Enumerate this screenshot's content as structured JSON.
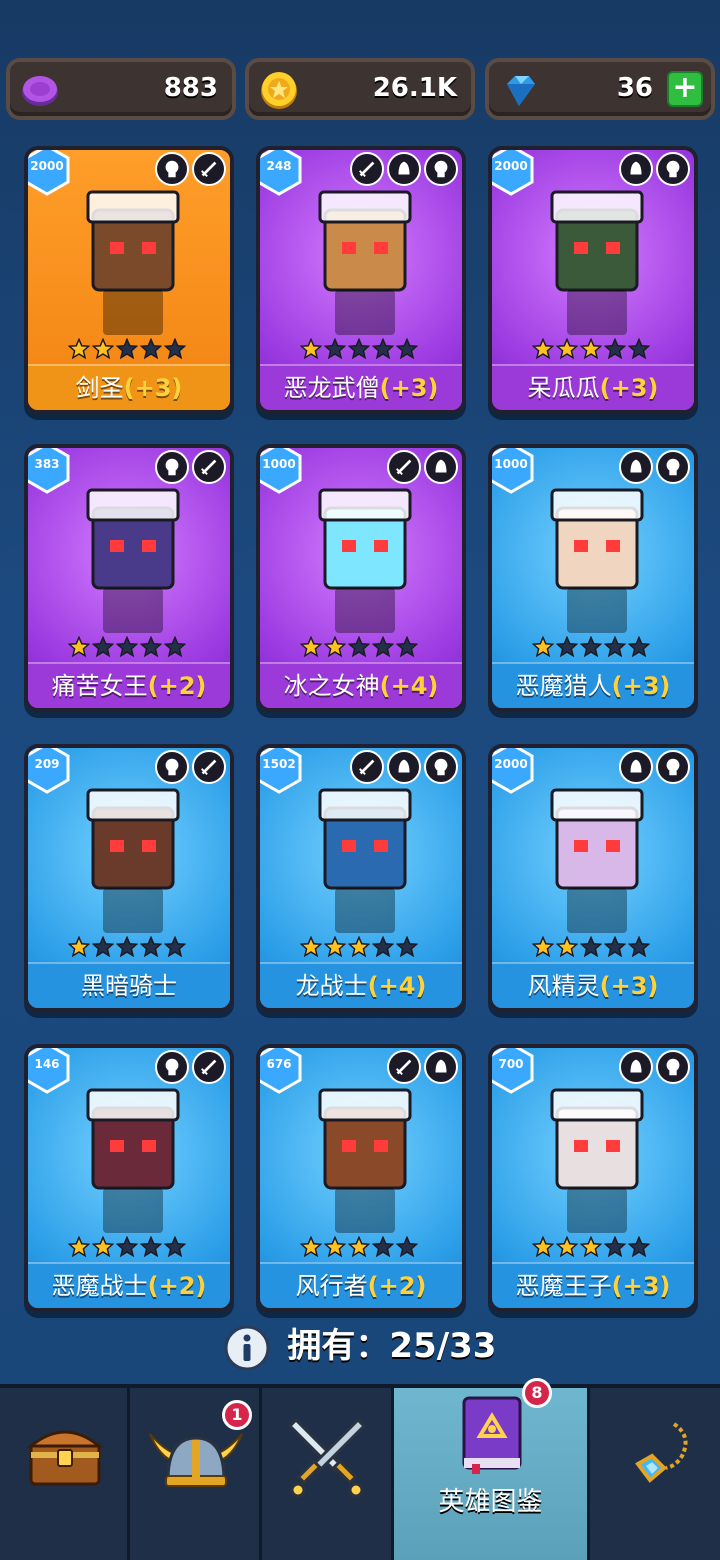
{
  "currencies": [
    {
      "icon": "purple-gem-icon",
      "value": "883"
    },
    {
      "icon": "gold-coin-icon",
      "value": "26.1K"
    },
    {
      "icon": "diamond-icon",
      "value": "36"
    }
  ],
  "plus_label": "+",
  "heroes": [
    {
      "name": "剑圣",
      "bonus": "(+3)",
      "level": "2000",
      "stars": 2,
      "rarity": "gold"
    },
    {
      "name": "恶龙武僧",
      "bonus": "(+3)",
      "level": "248",
      "stars": 1,
      "rarity": "purple"
    },
    {
      "name": "呆瓜瓜",
      "bonus": "(+3)",
      "level": "2000",
      "stars": 3,
      "rarity": "purple"
    },
    {
      "name": "痛苦女王",
      "bonus": "(+2)",
      "level": "383",
      "stars": 1,
      "rarity": "purple"
    },
    {
      "name": "冰之女神",
      "bonus": "(+4)",
      "level": "1000",
      "stars": 2,
      "rarity": "purple"
    },
    {
      "name": "恶魔猎人",
      "bonus": "(+3)",
      "level": "1000",
      "stars": 1,
      "rarity": "blue"
    },
    {
      "name": "黑暗骑士",
      "bonus": "",
      "level": "209",
      "stars": 1,
      "rarity": "blue"
    },
    {
      "name": "龙战士",
      "bonus": "(+4)",
      "level": "1502",
      "stars": 3,
      "rarity": "blue"
    },
    {
      "name": "风精灵",
      "bonus": "(+3)",
      "level": "2000",
      "stars": 2,
      "rarity": "blue"
    },
    {
      "name": "恶魔战士",
      "bonus": "(+2)",
      "level": "146",
      "stars": 2,
      "rarity": "blue"
    },
    {
      "name": "风行者",
      "bonus": "(+2)",
      "level": "676",
      "stars": 3,
      "rarity": "blue"
    },
    {
      "name": "恶魔王子",
      "bonus": "(+3)",
      "level": "700",
      "stars": 3,
      "rarity": "blue"
    }
  ],
  "owned": {
    "label": "拥有：",
    "value": "25/33"
  },
  "nav": {
    "items": [
      {
        "icon": "treasure-chest-icon"
      },
      {
        "icon": "viking-helmet-icon",
        "badge": "1"
      },
      {
        "icon": "crossed-swords-icon"
      },
      {
        "icon": "hero-book-icon",
        "badge": "8",
        "label": "英雄图鉴",
        "active": true
      },
      {
        "icon": "amulet-icon"
      }
    ]
  }
}
